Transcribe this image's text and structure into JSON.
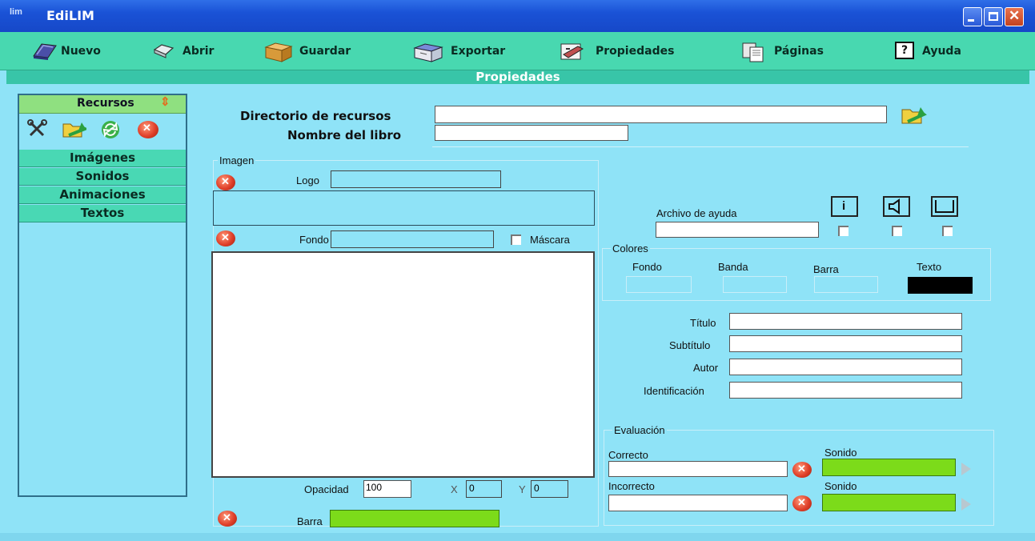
{
  "window": {
    "title": "EdiLIM",
    "icon_text": "lim"
  },
  "toolbar": {
    "nuevo": "Nuevo",
    "abrir": "Abrir",
    "guardar": "Guardar",
    "exportar": "Exportar",
    "propiedades": "Propiedades",
    "paginas": "Páginas",
    "ayuda": "Ayuda",
    "ayuda_icon_text": "?"
  },
  "band": {
    "title": "Propiedades"
  },
  "resources": {
    "header": "Recursos",
    "items": [
      "Imágenes",
      "Sonidos",
      "Animaciones",
      "Textos"
    ]
  },
  "form": {
    "dir_label": "Directorio de recursos",
    "dir_value": "",
    "book_label": "Nombre del libro",
    "book_value": ""
  },
  "image": {
    "group_title": "Imagen",
    "logo_label": "Logo",
    "fondo_label": "Fondo",
    "mascara_label": "Máscara",
    "opacidad_label": "Opacidad",
    "opacidad_value": "100",
    "x_label": "X",
    "x_value": "0",
    "y_label": "Y",
    "y_value": "0",
    "barra_label": "Barra"
  },
  "help": {
    "label": "Archivo de ayuda",
    "info_icon_text": "i"
  },
  "colors": {
    "group_title": "Colores",
    "fondo": "Fondo",
    "banda": "Banda",
    "barra": "Barra",
    "texto": "Texto",
    "swatch_fondo": "#8fe3f7",
    "swatch_banda": "#8fe3f7",
    "swatch_barra": "#8fe3f7",
    "swatch_texto": "#000000"
  },
  "meta": {
    "titulo": "Título",
    "subtitulo": "Subtítulo",
    "autor": "Autor",
    "identificacion": "Identificación"
  },
  "evaluation": {
    "group_title": "Evaluación",
    "correcto": "Correcto",
    "incorrecto": "Incorrecto",
    "sonido": "Sonido"
  },
  "accent_colors": {
    "title_bar": "#1a52d6",
    "toolbar": "#48d8b0",
    "panel": "#8fe3f7",
    "green": "#7cdb1a"
  }
}
